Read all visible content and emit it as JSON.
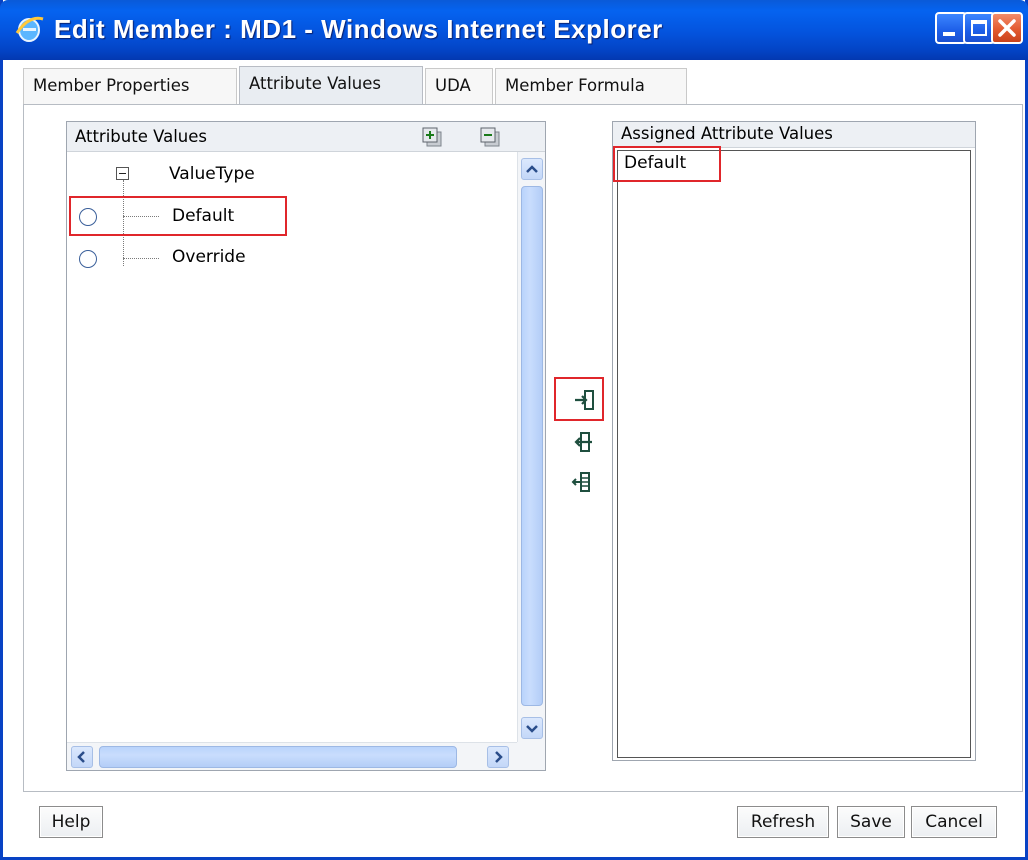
{
  "window": {
    "title": "Edit Member : MD1 - Windows Internet Explorer",
    "titlebar_color": "#0453dd",
    "controls": [
      "minimize-icon",
      "maximize-icon",
      "close-icon"
    ]
  },
  "tabs": [
    {
      "label": "Member Properties",
      "active": false
    },
    {
      "label": "Attribute Values",
      "active": true
    },
    {
      "label": "UDA",
      "active": false
    },
    {
      "label": "Member Formula",
      "active": false
    }
  ],
  "left_panel": {
    "header": "Attribute Values",
    "header_icons": [
      "expand-all-icon",
      "collapse-all-icon"
    ],
    "tree": {
      "root_label": "ValueType",
      "items": [
        {
          "label": "Default",
          "selected": false,
          "highlighted": true
        },
        {
          "label": "Override",
          "selected": false,
          "highlighted": false
        }
      ]
    }
  },
  "move_buttons": [
    {
      "icon": "move-right-icon",
      "highlighted": true
    },
    {
      "icon": "move-left-icon",
      "highlighted": false
    },
    {
      "icon": "move-all-left-icon",
      "highlighted": false
    }
  ],
  "right_panel": {
    "header": "Assigned Attribute Values",
    "items": [
      {
        "label": "Default",
        "highlighted": true
      }
    ]
  },
  "footer": {
    "help_label": "Help",
    "refresh_label": "Refresh",
    "save_label": "Save",
    "cancel_label": "Cancel"
  },
  "colors": {
    "highlight": "#e0262b",
    "accent": "#3a5f9a"
  }
}
